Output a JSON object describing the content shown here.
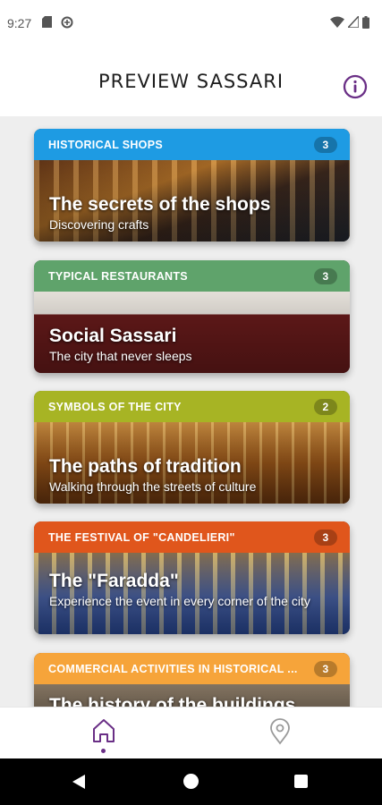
{
  "status_bar": {
    "time": "9:27"
  },
  "header": {
    "title": "PREVIEW SASSARI"
  },
  "cards": [
    {
      "category": "HISTORICAL SHOPS",
      "count": "3",
      "title": "The secrets of the shops",
      "subtitle": "Discovering crafts",
      "color": "#1e9be3"
    },
    {
      "category": "TYPICAL RESTAURANTS",
      "count": "3",
      "title": "Social Sassari",
      "subtitle": "The city that never sleeps",
      "color": "#5fa36b"
    },
    {
      "category": "SYMBOLS OF THE CITY",
      "count": "2",
      "title": "The paths of tradition",
      "subtitle": "Walking through the streets of culture",
      "color": "#a7b424"
    },
    {
      "category": "THE FESTIVAL OF \"CANDELIERI\"",
      "count": "3",
      "title": "The \"Faradda\"",
      "subtitle": "Experience the event in every corner of the city",
      "color": "#e0561c"
    },
    {
      "category": "COMMERCIAL ACTIVITIES IN HISTORICAL ...",
      "count": "3",
      "title": "The history of the buildings",
      "subtitle": "",
      "color": "#f6a43a"
    }
  ],
  "bottom_nav": [
    {
      "icon": "home-icon",
      "active": true
    },
    {
      "icon": "map-pin-icon",
      "active": false
    }
  ],
  "accent_color": "#6a2f86"
}
